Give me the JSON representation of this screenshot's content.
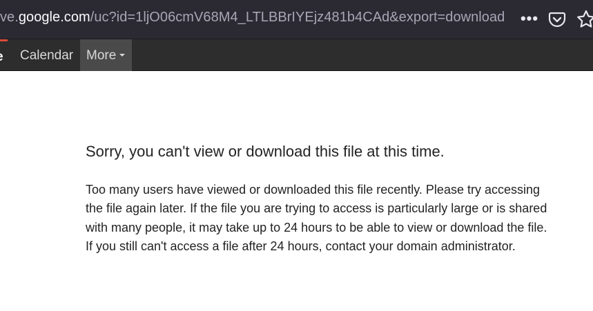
{
  "browser": {
    "url_prefix": "ve.",
    "url_host": "google.com",
    "url_path": "/uc?id=1ljO06cmV68M4_LTLBBrIYEjz481b4CAd&export=download",
    "menu_dots": "•••",
    "icons": [
      "pocket-icon",
      "star-icon"
    ]
  },
  "nav": {
    "partial_item": "e",
    "calendar": "Calendar",
    "more": "More",
    "active_color": "#dd4b39"
  },
  "error": {
    "title": "Sorry, you can't view or download this file at this time.",
    "message": "Too many users have viewed or downloaded this file recently. Please try accessing the file again later. If the file you are trying to access is particularly large or is shared with many people, it may take up to 24 hours to be able to view or download the file. If you still can't access a file after 24 hours, contact your domain administrator."
  }
}
